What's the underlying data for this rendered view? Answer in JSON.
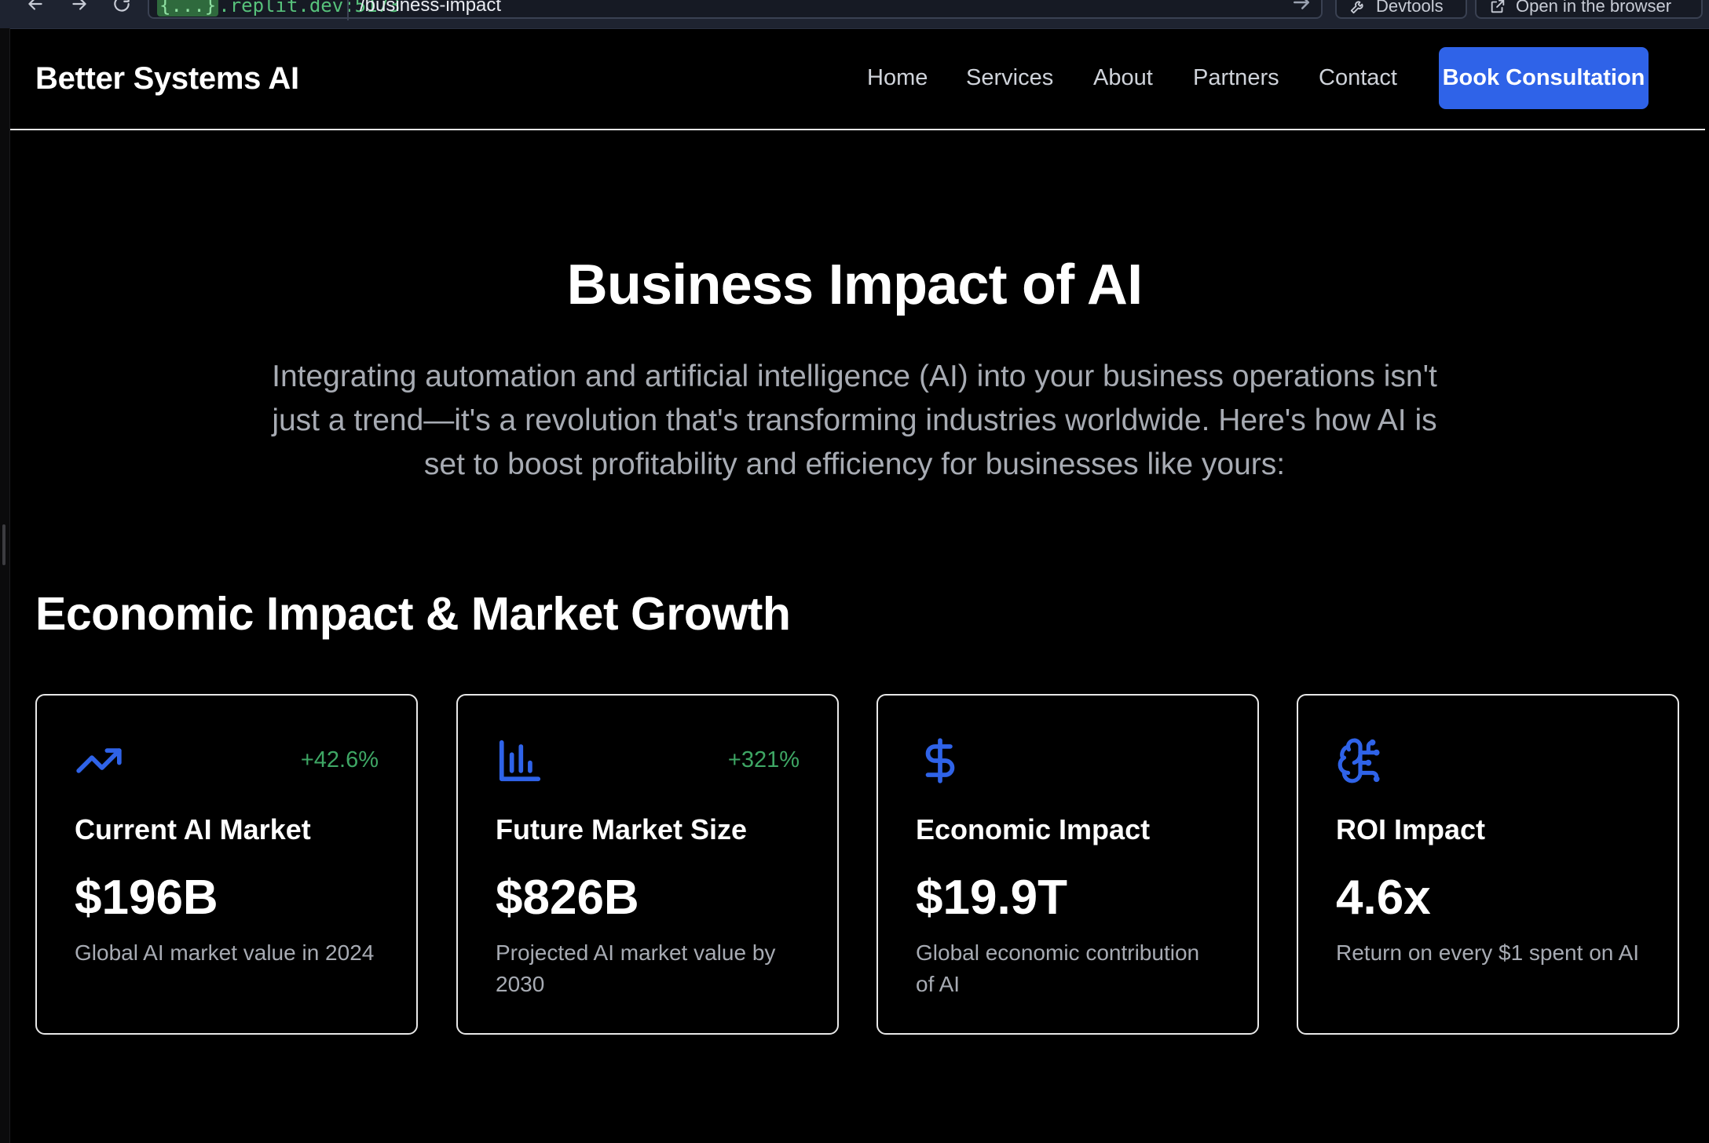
{
  "browser": {
    "url_host_token": "{...}",
    "url_host_rest": ".replit.dev:5173",
    "url_path": "/business-impact",
    "devtools_label": "Devtools",
    "open_browser_label": "Open in the browser",
    "icons": [
      "back-arrow-icon",
      "forward-arrow-icon",
      "reload-icon",
      "go-arrow-icon",
      "wrench-icon",
      "external-link-icon"
    ]
  },
  "header": {
    "brand": "Better Systems AI",
    "nav": [
      "Home",
      "Services",
      "About",
      "Partners",
      "Contact"
    ],
    "cta": "Book Consultation"
  },
  "hero": {
    "title": "Business Impact of AI",
    "text": "Integrating automation and artificial intelligence (AI) into your business operations isn't just a trend—it's a revolution that's transforming industries worldwide. Here's how AI is set to boost profitability and efficiency for businesses like yours:"
  },
  "section": {
    "title": "Economic Impact & Market Growth",
    "cards": [
      {
        "icon": "trending-up-icon",
        "change": "+42.6%",
        "title": "Current AI Market",
        "value": "$196B",
        "description": "Global AI market value in 2024"
      },
      {
        "icon": "bar-chart-icon",
        "change": "+321%",
        "title": "Future Market Size",
        "value": "$826B",
        "description": "Projected AI market value by 2030"
      },
      {
        "icon": "dollar-sign-icon",
        "change": "",
        "title": "Economic Impact",
        "value": "$19.9T",
        "description": "Global economic contribution of AI"
      },
      {
        "icon": "brain-circuit-icon",
        "change": "",
        "title": "ROI Impact",
        "value": "4.6x",
        "description": "Return on every $1 spent on AI"
      }
    ]
  },
  "colors": {
    "accent": "#2f63e8",
    "positive": "#3ea664",
    "background": "#000000",
    "muted_text": "#a7abb3"
  }
}
